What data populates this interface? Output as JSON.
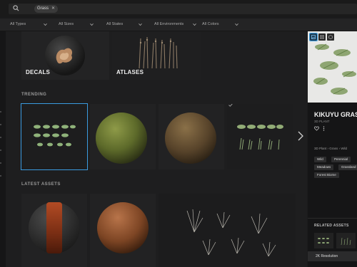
{
  "search": {
    "chip_label": "Grass",
    "icon": "search-icon"
  },
  "filters": [
    {
      "label": "All Types"
    },
    {
      "label": "All Sizes"
    },
    {
      "label": "All States"
    },
    {
      "label": "All Environments"
    },
    {
      "label": "All Colors"
    }
  ],
  "categories": [
    {
      "label": "DECALS"
    },
    {
      "label": "ATLASES"
    }
  ],
  "sections": {
    "trending": "TRENDING",
    "latest": "LATEST ASSETS"
  },
  "detail": {
    "title": "KIKUYU GRASS",
    "subtitle": "3D PLANT",
    "breadcrumb": [
      "3D Plant",
      "Grass",
      "Wild"
    ],
    "tags": [
      "Wild",
      "Perennial",
      "Meadows",
      "Grassland",
      "Forest Biome"
    ],
    "related_title": "RELATED ASSETS",
    "resolution": "2K Resolution"
  },
  "colors": {
    "accent": "#3a9be0",
    "background": "#1b1b1c"
  }
}
